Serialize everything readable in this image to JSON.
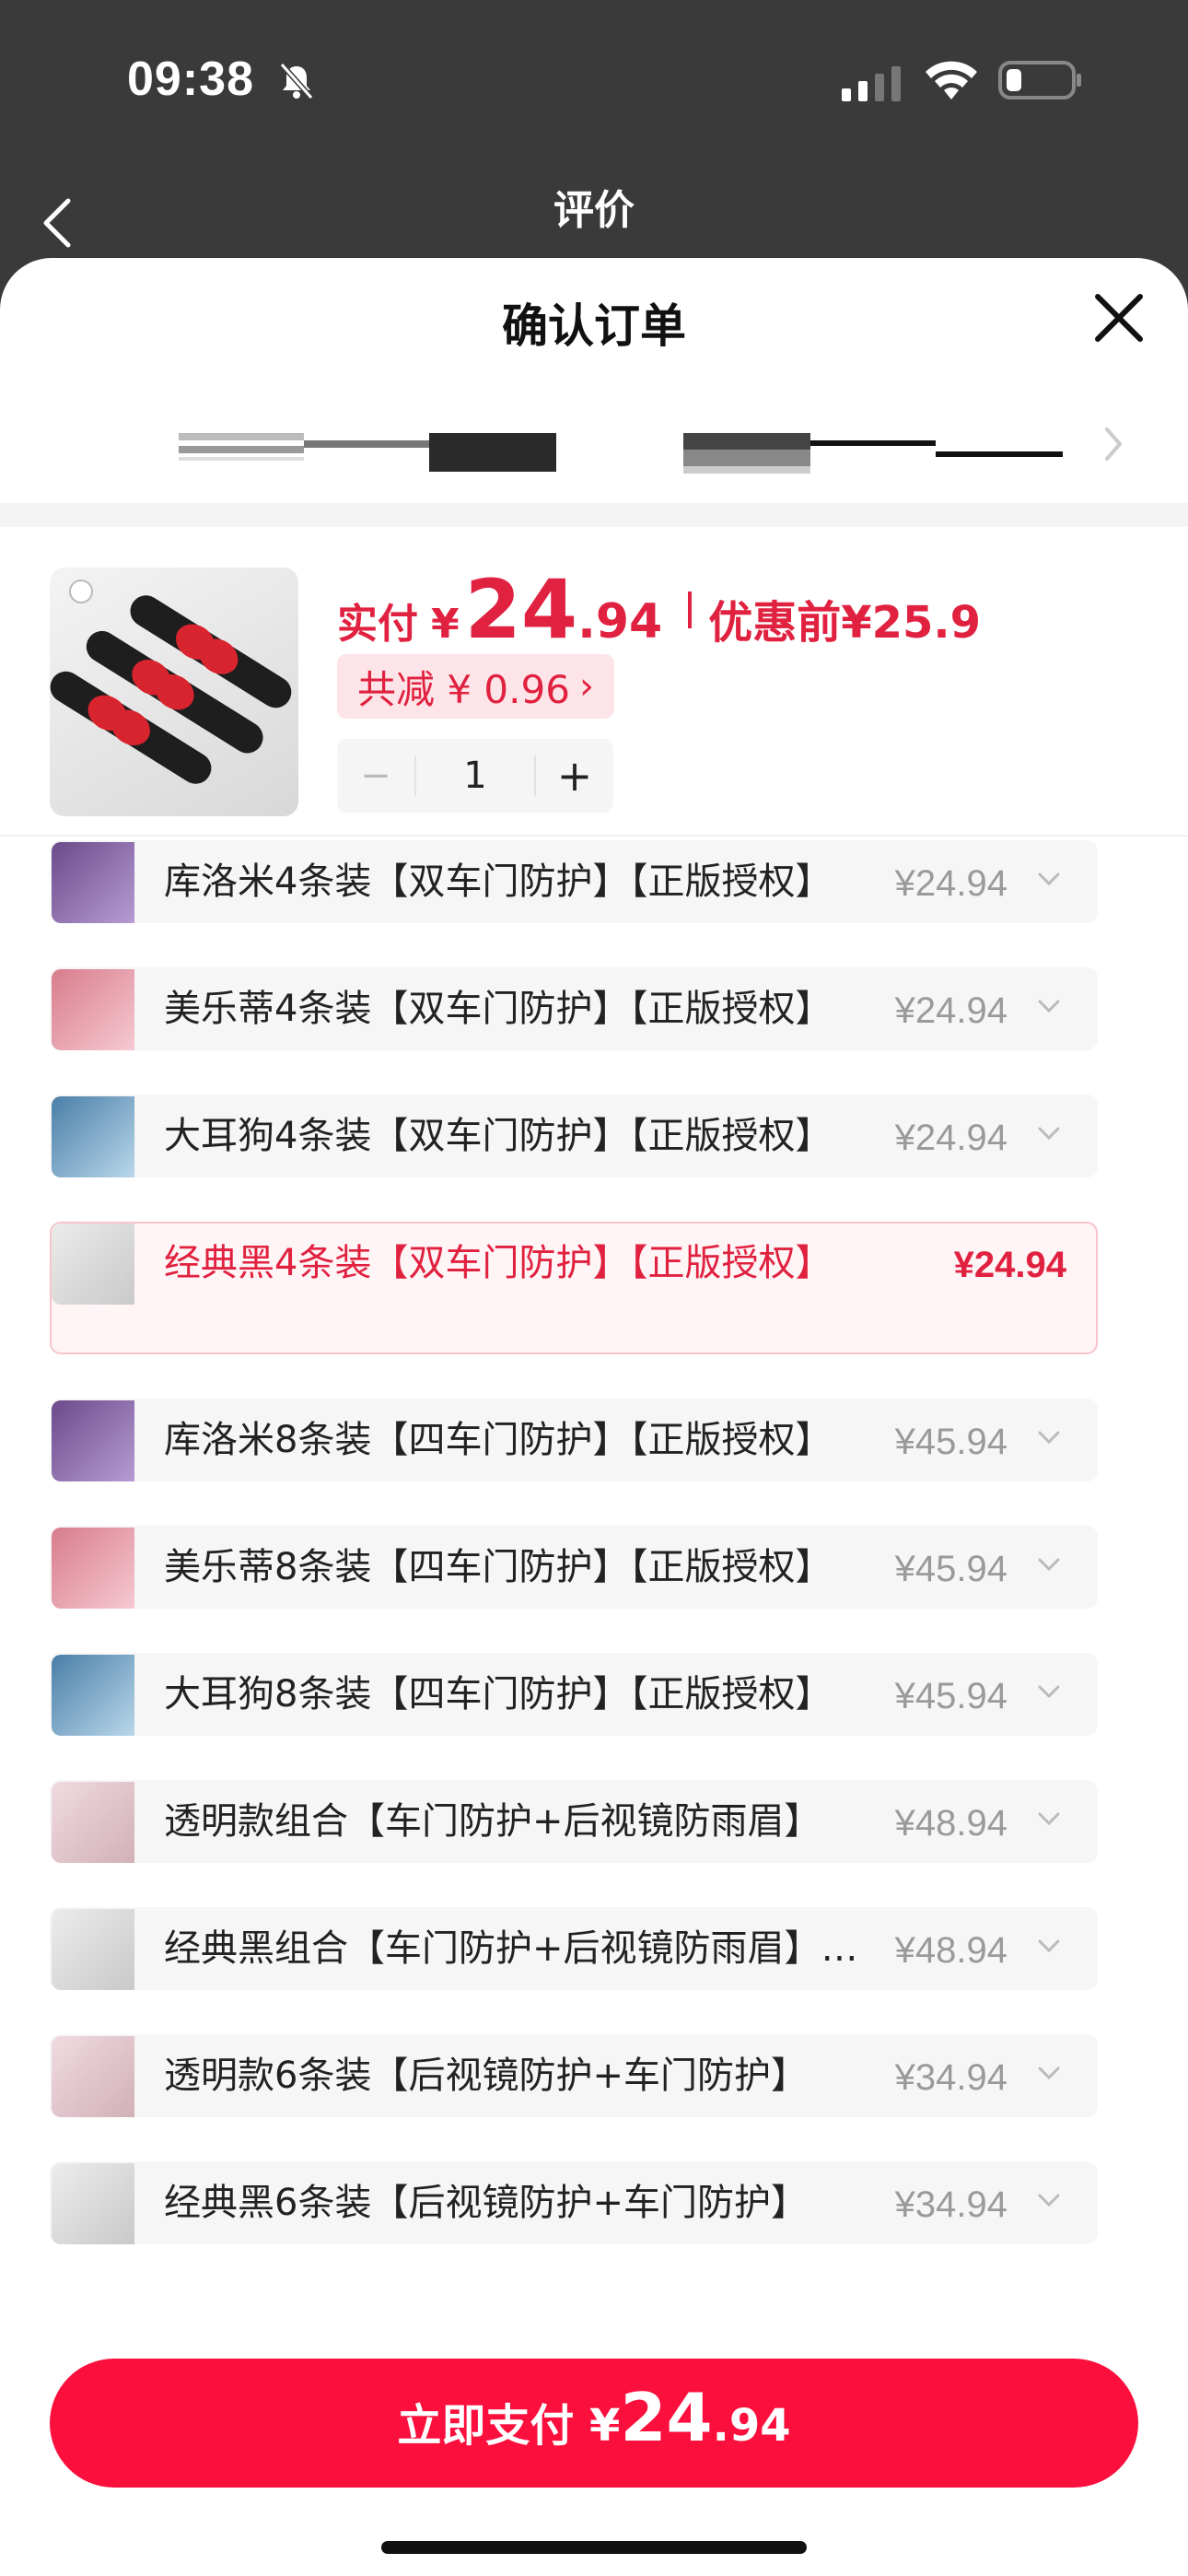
{
  "status_bar": {
    "time": "09:38"
  },
  "background_page": {
    "title": "评价"
  },
  "sheet": {
    "title": "确认订单"
  },
  "product": {
    "price_label": "实付",
    "currency": "¥",
    "price_int": "24",
    "price_dec": ".94",
    "original_label": "优惠前",
    "original_price": "¥25.9",
    "discount": "共减 ¥ 0.96",
    "discount_chevron": "›",
    "quantity": "1",
    "minus": "−",
    "plus": "+"
  },
  "variants": [
    {
      "label": "库洛米4条装【双车门防护】【正版授权】",
      "price": "¥24.94",
      "thumb": "purple"
    },
    {
      "label": "美乐蒂4条装【双车门防护】【正版授权】",
      "price": "¥24.94",
      "thumb": "pink"
    },
    {
      "label": "大耳狗4条装【双车门防护】【正版授权】",
      "price": "¥24.94",
      "thumb": "blue"
    },
    {
      "label": "经典黑4条装【双车门防护】【正版授权】",
      "price": "¥24.94",
      "thumb": "black",
      "selected": true
    },
    {
      "label": "库洛米8条装【四车门防护】【正版授权】",
      "price": "¥45.94",
      "thumb": "purple"
    },
    {
      "label": "美乐蒂8条装【四车门防护】【正版授权】",
      "price": "¥45.94",
      "thumb": "pink"
    },
    {
      "label": "大耳狗8条装【四车门防护】【正版授权】",
      "price": "¥45.94",
      "thumb": "blue"
    },
    {
      "label": "透明款组合【车门防护+后视镜防雨眉】",
      "price": "¥48.94",
      "thumb": "clear"
    },
    {
      "label": "经典黑组合【车门防护+后视镜防雨眉】【正版授权】",
      "price": "¥48.94",
      "thumb": "black"
    },
    {
      "label": "透明款6条装【后视镜防护+车门防护】",
      "price": "¥34.94",
      "thumb": "clear"
    },
    {
      "label": "经典黑6条装【后视镜防护+车门防护】",
      "price": "¥34.94",
      "thumb": "black"
    }
  ],
  "pay": {
    "label": "立即支付 ¥",
    "price_int": "24",
    "price_dec": ".94"
  },
  "colors": {
    "accent": "#e0213f",
    "pay_button": "#fa0f3d",
    "discount_bg": "#fde4e8"
  }
}
